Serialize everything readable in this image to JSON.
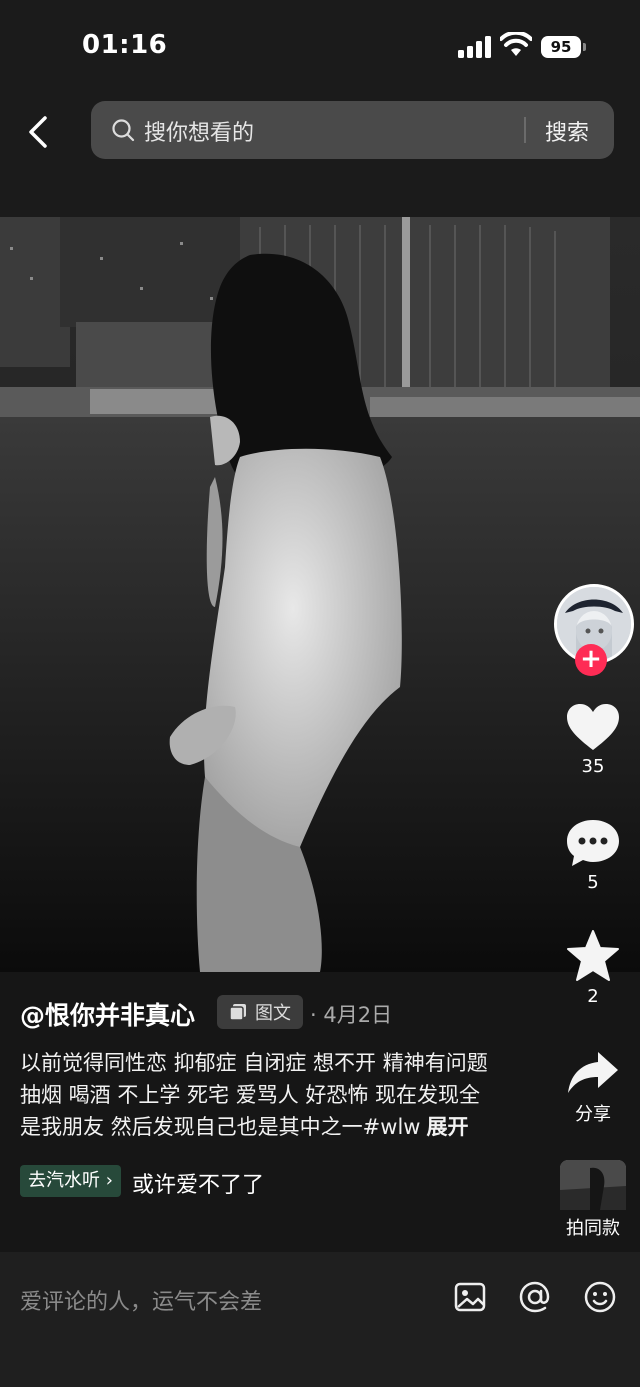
{
  "status": {
    "time": "01:16",
    "battery": "95"
  },
  "search": {
    "placeholder": "搜你想看的",
    "button": "搜索"
  },
  "actions": {
    "likes": "35",
    "comments": "5",
    "favorites": "2",
    "share": "分享",
    "shoot_same": "拍同款"
  },
  "post": {
    "author": "@恨你并非真心",
    "type_badge": "图文",
    "date": "· 4月2日",
    "caption": "以前觉得同性恋 抑郁症 自闭症 想不开 精神有问题 抽烟 喝酒 不上学 死宅 爱骂人 好恐怖 现在发现全是我朋友 然后发现自己也是其中之一#wlw",
    "expand": "展开",
    "music_tag": "去汽水听",
    "music_title": "或许爱不了了"
  },
  "comment_bar": {
    "placeholder": "爱评论的人，运气不会差"
  },
  "icons": {
    "back": "chevron-left-icon",
    "search": "search-icon",
    "like": "heart-icon",
    "comment": "chat-bubble-icon",
    "favorite": "star-icon",
    "share": "share-arrow-icon",
    "image": "image-icon",
    "mention": "at-icon",
    "emoji": "emoji-icon"
  },
  "colors": {
    "follow": "#fe2c55",
    "music_tag": "#27493a"
  }
}
